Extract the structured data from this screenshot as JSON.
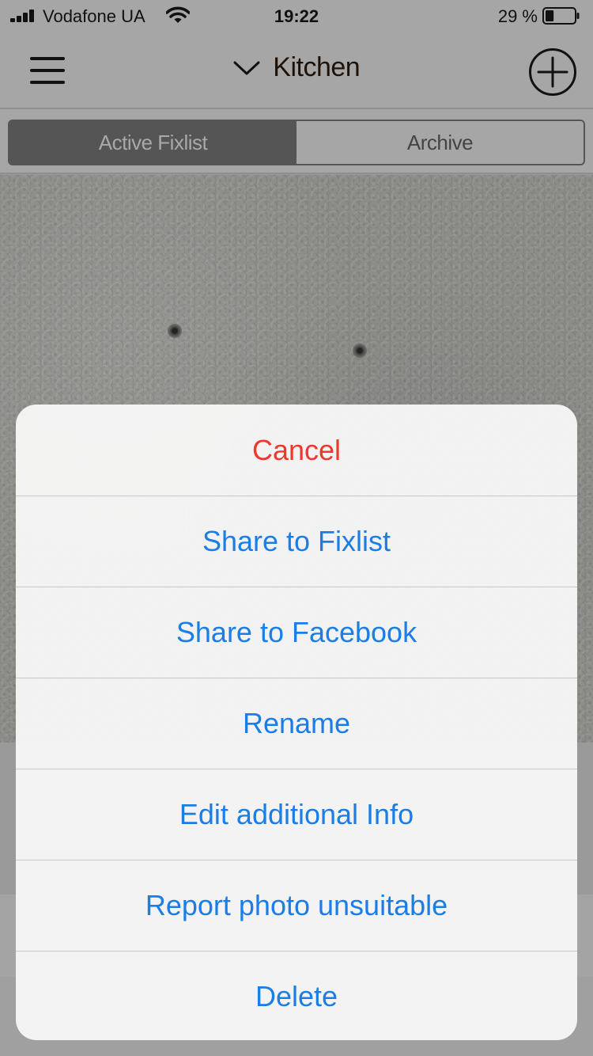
{
  "status_bar": {
    "carrier": "Vodafone UA",
    "time": "19:22",
    "battery": "29 %",
    "battery_level": 0.29
  },
  "nav": {
    "title": "Kitchen",
    "menu_icon": "hamburger-icon",
    "chevron_icon": "chevron-down-icon",
    "add_icon": "plus-circle-icon"
  },
  "segments": {
    "active": "Active Fixlist",
    "archive": "Archive"
  },
  "action_sheet": {
    "cancel": "Cancel",
    "share_fixlist": "Share to Fixlist",
    "share_facebook": "Share to Facebook",
    "rename": "Rename",
    "edit_info": "Edit additional Info",
    "report": "Report photo unsuitable",
    "delete": "Delete"
  },
  "colors": {
    "action_blue": "#1a7ee6",
    "cancel_red": "#f0372d"
  }
}
